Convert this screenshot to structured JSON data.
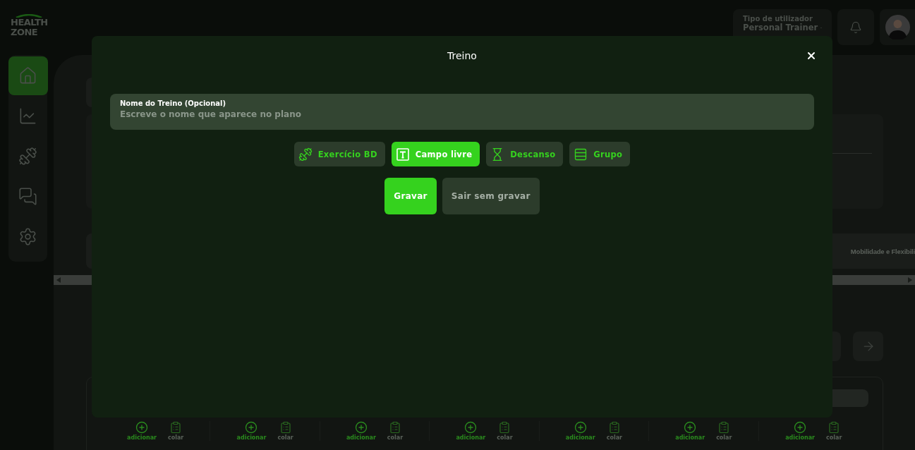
{
  "app": {
    "logo": {
      "line1": "HEALTH",
      "line2": "ZONE"
    },
    "nav": [
      {
        "kind": "home",
        "selected": true
      },
      {
        "kind": "stats",
        "selected": false
      },
      {
        "kind": "workouts",
        "selected": false
      },
      {
        "kind": "messages",
        "selected": false
      },
      {
        "kind": "settings",
        "selected": false
      }
    ],
    "user_type": {
      "label": "Tipo de utilizador",
      "value": "Personal Trainer"
    },
    "tab_strip_label": "Mobilidade e Flexibili",
    "slots": [
      {
        "add": "adicionar",
        "paste": "colar"
      },
      {
        "add": "adicionar",
        "paste": "colar"
      },
      {
        "add": "adicionar",
        "paste": "colar"
      },
      {
        "add": "adicionar",
        "paste": "colar"
      },
      {
        "add": "adicionar",
        "paste": "colar"
      },
      {
        "add": "adicionar",
        "paste": "colar"
      },
      {
        "add": "adicionar",
        "paste": "colar"
      }
    ]
  },
  "modal": {
    "title": "Treino",
    "field": {
      "label": "Nome do Treino (Opcional)",
      "placeholder": "Escreve o nome que aparece no plano"
    },
    "types": [
      {
        "kind": "exercise",
        "label": "Exercício BD",
        "selected": false
      },
      {
        "kind": "free",
        "label": "Campo livre",
        "selected": true
      },
      {
        "kind": "rest",
        "label": "Descanso",
        "selected": false
      },
      {
        "kind": "group",
        "label": "Grupo",
        "selected": false
      }
    ],
    "actions": [
      {
        "kind": "primary",
        "label": "Gravar"
      },
      {
        "kind": "secondary",
        "label": "Sair sem gravar"
      }
    ]
  }
}
